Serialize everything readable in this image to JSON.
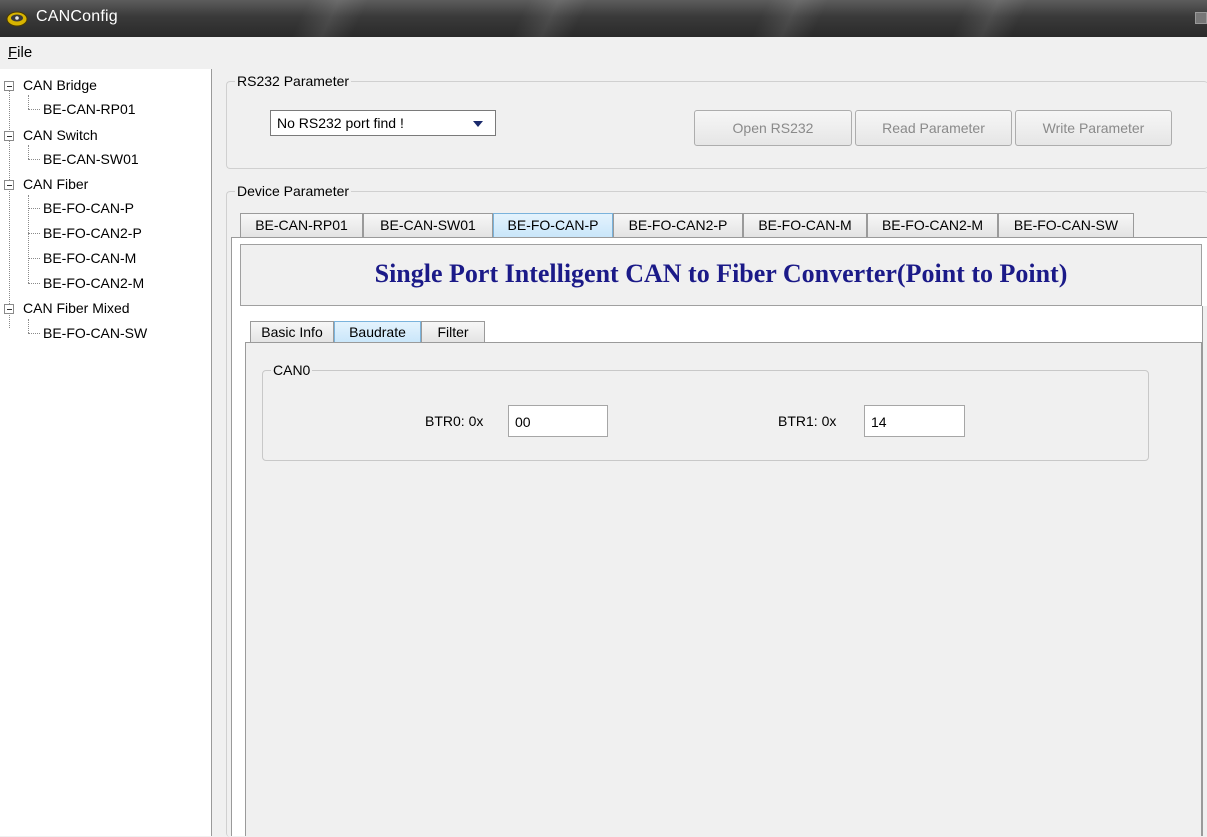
{
  "window": {
    "title": "CANConfig",
    "icon": "app-icon"
  },
  "menu": {
    "file": {
      "underline": "F",
      "rest": "ile"
    }
  },
  "tree": {
    "groups": [
      {
        "label": "CAN Bridge",
        "children": [
          "BE-CAN-RP01"
        ]
      },
      {
        "label": "CAN Switch",
        "children": [
          "BE-CAN-SW01"
        ]
      },
      {
        "label": "CAN Fiber",
        "children": [
          "BE-FO-CAN-P",
          "BE-FO-CAN2-P",
          "BE-FO-CAN-M",
          "BE-FO-CAN2-M"
        ]
      },
      {
        "label": "CAN Fiber Mixed",
        "children": [
          "BE-FO-CAN-SW"
        ]
      }
    ]
  },
  "rs232": {
    "legend": "RS232 Parameter",
    "port_value": "No RS232 port find !",
    "open_label": "Open RS232",
    "read_label": "Read Parameter",
    "write_label": "Write Parameter"
  },
  "device": {
    "legend": "Device Parameter",
    "tabs": [
      "BE-CAN-RP01",
      "BE-CAN-SW01",
      "BE-FO-CAN-P",
      "BE-FO-CAN2-P",
      "BE-FO-CAN-M",
      "BE-FO-CAN2-M",
      "BE-FO-CAN-SW"
    ],
    "active_tab": "BE-FO-CAN-P",
    "headline": "Single Port Intelligent CAN to Fiber Converter(Point to Point)",
    "headline_color": "#1b1a88",
    "subtabs": [
      "Basic Info",
      "Baudrate",
      "Filter"
    ],
    "active_subtab": "Baudrate"
  },
  "can0": {
    "legend": "CAN0",
    "btr0_label": "BTR0: 0x",
    "btr0_value": "00",
    "btr1_label": "BTR1: 0x",
    "btr1_value": "14"
  }
}
